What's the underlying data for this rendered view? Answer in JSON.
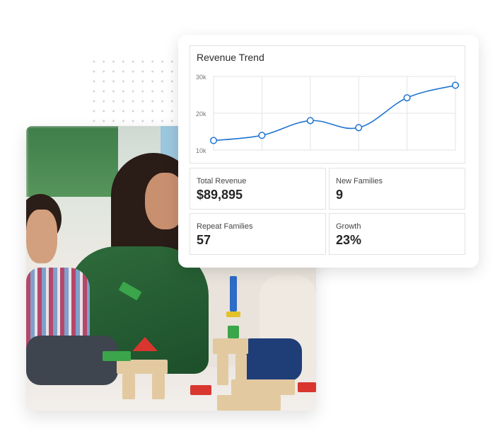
{
  "card": {
    "chart_title": "Revenue Trend",
    "tiles": [
      {
        "label": "Total Revenue",
        "value": "$89,895"
      },
      {
        "label": "New Families",
        "value": "9"
      },
      {
        "label": "Repeat Families",
        "value": "57"
      },
      {
        "label": "Growth",
        "value": "23%"
      }
    ]
  },
  "colors": {
    "line": "#1f74d1",
    "grid": "#e3e3e3",
    "axis_text": "#777777"
  },
  "chart_data": {
    "type": "line",
    "title": "Revenue Trend",
    "x": [
      1,
      2,
      3,
      4,
      5,
      6
    ],
    "series": [
      {
        "name": "Revenue",
        "values": [
          12600,
          14000,
          18000,
          16100,
          24200,
          27600
        ]
      }
    ],
    "ylim": [
      10000,
      30000
    ],
    "yticks": [
      10000,
      20000,
      30000
    ],
    "ytick_labels": [
      "10k",
      "20k",
      "30k"
    ],
    "xlabel": "",
    "ylabel": "",
    "grid": true,
    "smooth": true,
    "markers": "hollow-circle"
  },
  "photo": {
    "subject": "teacher-and-children-playing-with-blocks"
  }
}
